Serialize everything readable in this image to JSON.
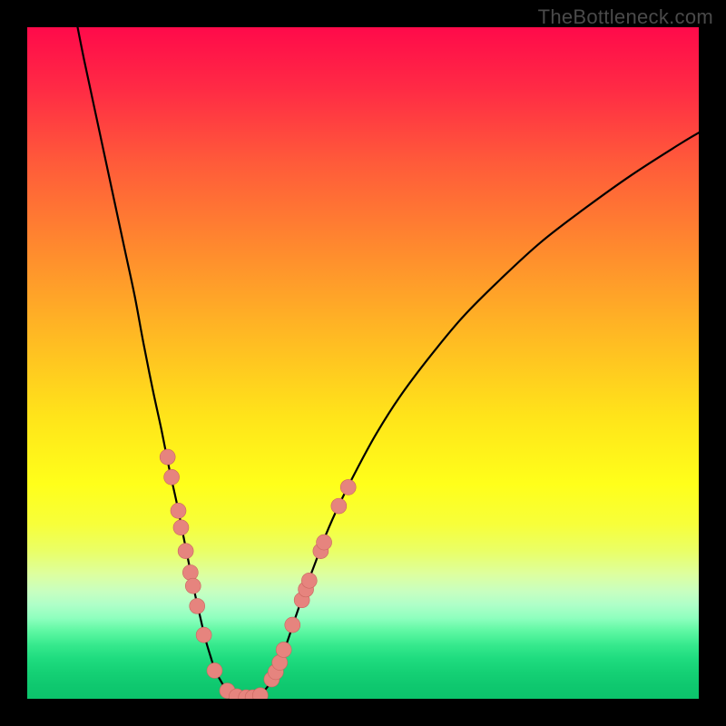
{
  "watermark": "TheBottleneck.com",
  "chart_data": {
    "type": "line",
    "title": "",
    "xlabel": "",
    "ylabel": "",
    "xlim": [
      0,
      100
    ],
    "ylim": [
      0,
      100
    ],
    "left_curve": {
      "name": "left-branch",
      "points": [
        [
          7.5,
          100
        ],
        [
          8.5,
          95
        ],
        [
          10,
          88
        ],
        [
          11.5,
          81
        ],
        [
          13,
          74
        ],
        [
          14.5,
          67
        ],
        [
          16,
          60
        ],
        [
          17.3,
          53
        ],
        [
          18.7,
          46
        ],
        [
          20,
          40
        ],
        [
          21.2,
          34
        ],
        [
          22.3,
          29
        ],
        [
          23.3,
          24
        ],
        [
          24.2,
          19.5
        ],
        [
          25,
          15.5
        ],
        [
          25.8,
          12
        ],
        [
          26.5,
          9
        ],
        [
          27.3,
          6.3
        ],
        [
          28,
          4.2
        ],
        [
          28.8,
          2.7
        ],
        [
          29.5,
          1.6
        ],
        [
          30.3,
          0.9
        ],
        [
          31.2,
          0.4
        ],
        [
          32,
          0.2
        ],
        [
          33,
          0.2
        ]
      ]
    },
    "right_curve": {
      "name": "right-branch",
      "points": [
        [
          33,
          0.2
        ],
        [
          33.8,
          0.25
        ],
        [
          34.6,
          0.6
        ],
        [
          35.4,
          1.3
        ],
        [
          36.2,
          2.4
        ],
        [
          37,
          4
        ],
        [
          37.9,
          6.2
        ],
        [
          38.9,
          9
        ],
        [
          40,
          12.3
        ],
        [
          41.3,
          16
        ],
        [
          42.8,
          20
        ],
        [
          44.5,
          24.5
        ],
        [
          46.5,
          29
        ],
        [
          49,
          34
        ],
        [
          52,
          39.5
        ],
        [
          55.5,
          45
        ],
        [
          60,
          51
        ],
        [
          65,
          57
        ],
        [
          70.5,
          62.5
        ],
        [
          76.5,
          68
        ],
        [
          83,
          73
        ],
        [
          90,
          78
        ],
        [
          97,
          82.5
        ],
        [
          100,
          84.3
        ]
      ]
    },
    "dots_left": [
      [
        20.9,
        36
      ],
      [
        21.5,
        33
      ],
      [
        22.5,
        28
      ],
      [
        22.9,
        25.5
      ],
      [
        23.6,
        22
      ],
      [
        24.3,
        18.8
      ],
      [
        24.7,
        16.8
      ],
      [
        25.3,
        13.8
      ],
      [
        26.3,
        9.5
      ],
      [
        27.9,
        4.2
      ],
      [
        29.8,
        1.2
      ],
      [
        31.2,
        0.35
      ],
      [
        32.6,
        0.2
      ]
    ],
    "dots_right": [
      [
        33.6,
        0.2
      ],
      [
        34.7,
        0.5
      ],
      [
        36.4,
        2.9
      ],
      [
        37.0,
        4.0
      ],
      [
        37.6,
        5.4
      ],
      [
        38.2,
        7.3
      ],
      [
        39.5,
        11.0
      ],
      [
        40.9,
        14.7
      ],
      [
        41.5,
        16.3
      ],
      [
        42,
        17.6
      ],
      [
        43.7,
        22
      ],
      [
        44.2,
        23.3
      ],
      [
        46.4,
        28.7
      ],
      [
        47.8,
        31.5
      ]
    ],
    "colors": {
      "dot_fill": "#e6847e",
      "dot_stroke": "#c9665f",
      "curve": "#000000"
    }
  }
}
